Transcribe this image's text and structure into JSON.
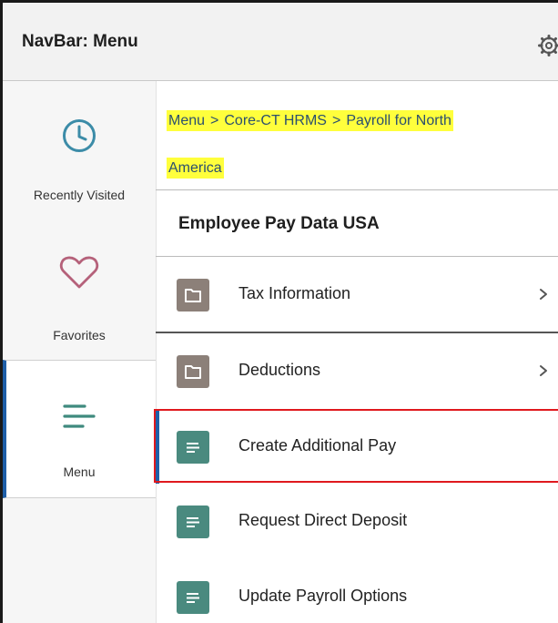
{
  "header": {
    "title": "NavBar: Menu",
    "settings_icon": "gear-icon"
  },
  "sidebar": {
    "items": [
      {
        "label": "Recently Visited",
        "icon": "clock-icon",
        "active": false
      },
      {
        "label": "Favorites",
        "icon": "heart-icon",
        "active": false
      },
      {
        "label": "Menu",
        "icon": "menu-lines-icon",
        "active": true
      }
    ]
  },
  "breadcrumb": {
    "items": [
      "Menu",
      "Core-CT HRMS",
      "Payroll for North",
      "America"
    ],
    "separator": ">",
    "highlight_color": "#ffff3c"
  },
  "section": {
    "title": "Employee Pay Data USA"
  },
  "list": {
    "items": [
      {
        "label": "Tax Information",
        "icon": "folder-icon",
        "has_children": true
      },
      {
        "label": "Deductions",
        "icon": "folder-icon",
        "has_children": true
      },
      {
        "label": "Create Additional Pay",
        "icon": "document-icon",
        "has_children": false,
        "selected": true
      },
      {
        "label": "Request Direct Deposit",
        "icon": "document-icon",
        "has_children": false
      },
      {
        "label": "Update Payroll Options",
        "icon": "document-icon",
        "has_children": false
      }
    ]
  },
  "colors": {
    "accent": "#1f5fa8",
    "folder_tile": "#8c8079",
    "doc_tile": "#4a8a7f",
    "annotation_box": "#e0191e",
    "icon_teal": "#3c8ca8",
    "icon_heart": "#b5617a"
  }
}
